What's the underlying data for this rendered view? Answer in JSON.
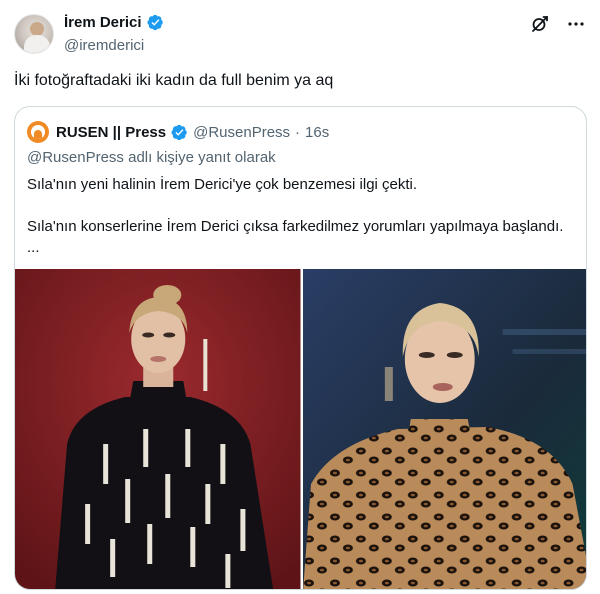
{
  "author": {
    "display_name": "İrem Derici",
    "handle": "@iremderici",
    "verified": true
  },
  "icons": [
    "grok-icon",
    "more-icon"
  ],
  "tweet": {
    "text": "İki fotoğraftadaki iki kadın da full benim ya aq"
  },
  "quoted": {
    "display_name": "RUSEN || Press",
    "handle": "@RusenPress",
    "separator": "·",
    "time": "16s",
    "reply_context": "@RusenPress adlı kişiye yanıt olarak",
    "paragraph1": "Sıla'nın yeni halinin İrem Derici'ye çok benzemesi ilgi çekti.",
    "paragraph2": "Sıla'nın konserlerine İrem Derici çıksa farkedilmez yorumları yapılmaya başlandı. ...",
    "photos": [
      {
        "subject": "woman in black embellished jacket on red background"
      },
      {
        "subject": "woman in leopard print top on dark blue stage background"
      }
    ]
  },
  "colors": {
    "verified": "#1d9bf0",
    "text": "#0f1419",
    "secondary": "#536471",
    "border": "#cfd9de",
    "quote_avatar": "#f08a24"
  }
}
